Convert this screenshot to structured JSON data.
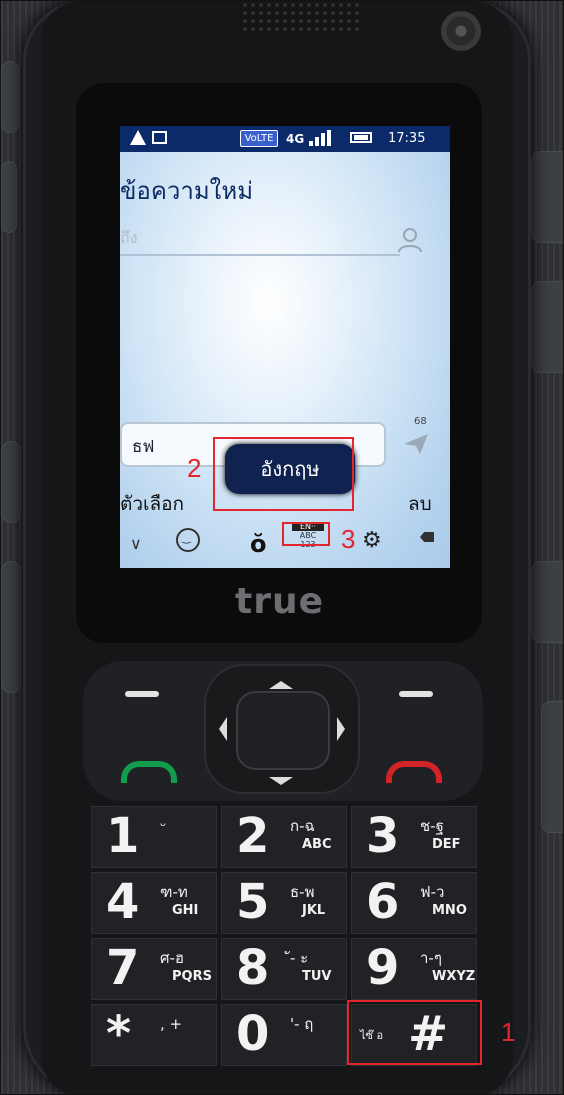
{
  "status_bar": {
    "volte": "VoLTE",
    "network": "4G",
    "time": "17:35"
  },
  "message": {
    "title": "ข้อความใหม่",
    "to_placeholder": "ถึง",
    "input_text": "ธฟ",
    "char_count": "68"
  },
  "popup": {
    "text": "อังกฤษ"
  },
  "softkeys": {
    "left": "ตัวเลือก",
    "right": "ลบ"
  },
  "input_bar": {
    "ime_current": "EN··",
    "ime_next1": "ABC",
    "ime_next2": "123"
  },
  "brand": "true",
  "keypad": {
    "keys": [
      {
        "num": "1",
        "sub": "ᵕ",
        "sub2": ""
      },
      {
        "num": "2",
        "sub": "ก-ฉ",
        "sub2": "ABC"
      },
      {
        "num": "3",
        "sub": "ช-ฐ",
        "sub2": "DEF"
      },
      {
        "num": "4",
        "sub": "ฑ-ท",
        "sub2": "GHI"
      },
      {
        "num": "5",
        "sub": "ธ-พ",
        "sub2": "JKL"
      },
      {
        "num": "6",
        "sub": "ฟ-ว",
        "sub2": "MNO"
      },
      {
        "num": "7",
        "sub": "ศ-ฮ",
        "sub2": "PQRS"
      },
      {
        "num": "8",
        "sub": "ั- ะ",
        "sub2": "TUV"
      },
      {
        "num": "9",
        "sub": "า-ๆ",
        "sub2": "WXYZ"
      },
      {
        "num": "*",
        "sub": ", +",
        "sub2": ""
      },
      {
        "num": "0",
        "sub": "'- ฤ",
        "sub2": ""
      },
      {
        "num": "#",
        "sub": "",
        "sub2": ""
      }
    ],
    "hash_prefix": "ไซ๊ อ"
  },
  "annotations": {
    "one": "1",
    "two": "2",
    "three": "3"
  },
  "colors": {
    "annotation": "#e3262b",
    "status_bar": "#0a2a6a",
    "popup": "#0f2250",
    "call": "#129c4d",
    "end": "#d42326"
  }
}
